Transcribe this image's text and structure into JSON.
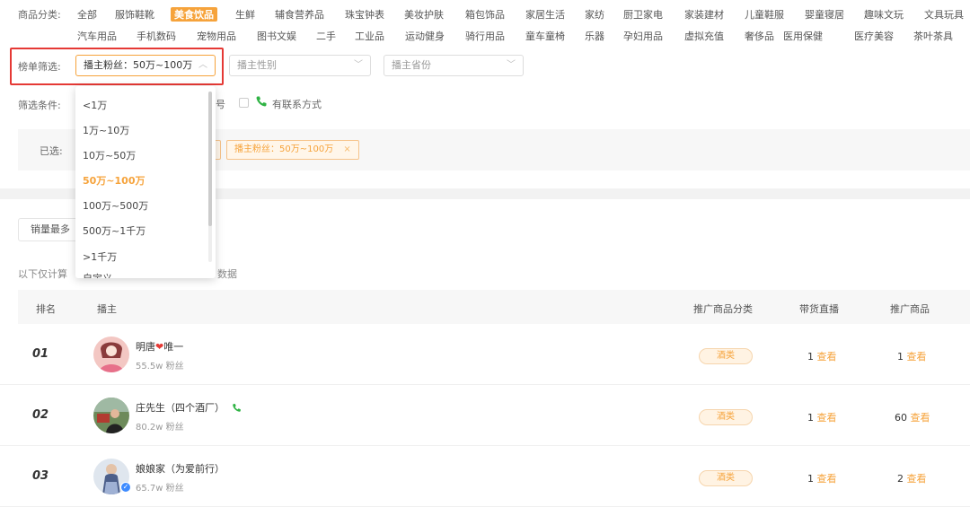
{
  "categories": {
    "label": "商品分类:",
    "row1": [
      "全部",
      "服饰鞋靴",
      "美食饮品",
      "生鲜",
      "辅食营养品",
      "珠宝钟表",
      "美妆护肤",
      "箱包饰品",
      "家居生活",
      "家纺",
      "厨卫家电",
      "家装建材",
      "儿童鞋服",
      "婴童寝居",
      "趣味文玩",
      "文具玩具"
    ],
    "row2": [
      "汽车用品",
      "手机数码",
      "宠物用品",
      "图书文娱",
      "二手",
      "工业品",
      "运动健身",
      "骑行用品",
      "童车童椅",
      "乐器",
      "孕妇用品",
      "虚拟充值",
      "奢侈品",
      "医用保健",
      "医疗美容",
      "茶叶茶具"
    ],
    "active": "美食饮品"
  },
  "filters": {
    "label": "榜单筛选:",
    "fans_select": "播主粉丝：50万~100万",
    "gender_select": "播主性别",
    "province_select": "播主省份"
  },
  "dropdown": {
    "options": [
      "<1万",
      "1万~10万",
      "10万~50万",
      "50万~100万",
      "100万~500万",
      "500万~1千万",
      ">1千万",
      "自定义"
    ],
    "selected": "50万~100万"
  },
  "conditions": {
    "label": "筛选条件:",
    "partial": "号",
    "contact": "有联系方式"
  },
  "selected": {
    "label": "已选:",
    "tag": "播主粉丝：50万~100万",
    "tag_close": "×"
  },
  "sort": {
    "button": "销量最多"
  },
  "note": {
    "left": "以下仅计算",
    "right": "数据"
  },
  "table": {
    "headers": {
      "rank": "排名",
      "streamer": "播主",
      "category": "推广商品分类",
      "live": "带货直播",
      "products": "推广商品"
    },
    "link_text": "查看",
    "rows": [
      {
        "rank": "01",
        "name_a": "明唐",
        "heart": "❤",
        "name_b": "唯一",
        "fans": "55.5w 粉丝",
        "category": "酒类",
        "live": "1",
        "products": "1"
      },
      {
        "rank": "02",
        "name_a": "庄先生（四个酒厂）",
        "heart": "",
        "name_b": "",
        "fans": "80.2w 粉丝",
        "category": "酒类",
        "live": "1",
        "products": "60"
      },
      {
        "rank": "03",
        "name_a": "娘娘家（为爱前行）",
        "heart": "",
        "name_b": "",
        "fans": "65.7w 粉丝",
        "category": "酒类",
        "live": "1",
        "products": "2"
      }
    ]
  },
  "colors": {
    "accent": "#f6a33b",
    "highlight": "#e53935",
    "phone": "#2fb344"
  }
}
